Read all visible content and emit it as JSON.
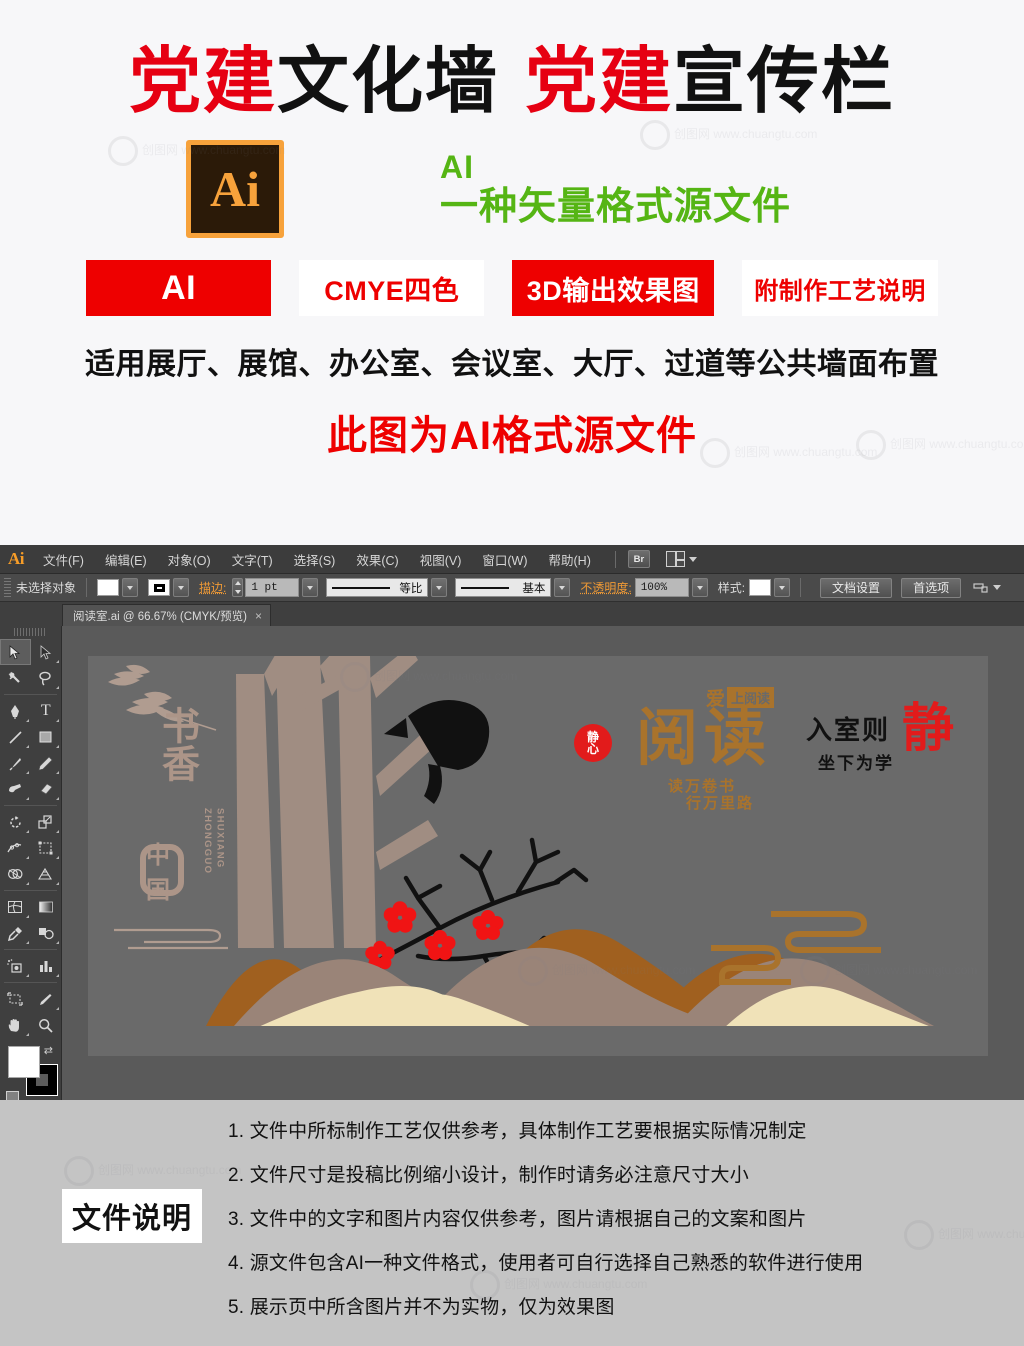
{
  "promo": {
    "title": {
      "seg1_red": "党建",
      "seg2_black": "文化墙",
      "seg3_red": "党建",
      "seg4_black": "宣传栏"
    },
    "ai_logo_text": "Ai",
    "green_line1": "AI",
    "green_line2": "一种矢量格式源文件",
    "badges": [
      {
        "label": "AI",
        "bg": "#ee0000",
        "fg": "#ffffff"
      },
      {
        "label": "CMYE四色",
        "bg": "#ffffff",
        "fg": "#ee0000"
      },
      {
        "label": "3D输出效果图",
        "bg": "#ee0000",
        "fg": "#ffffff"
      },
      {
        "label": "附制作工艺说明",
        "bg": "#ffffff",
        "fg": "#ee0000"
      }
    ],
    "subtitle": "适用展厅、展馆、办公室、会议室、大厅、过道等公共墙面布置",
    "note": "此图为AI格式源文件",
    "watermark": "创图网 www.chuangtu.com"
  },
  "app": {
    "logo": "Ai",
    "menus": [
      "文件(F)",
      "编辑(E)",
      "对象(O)",
      "文字(T)",
      "选择(S)",
      "效果(C)",
      "视图(V)",
      "窗口(W)",
      "帮助(H)"
    ],
    "bridge_button": "Br",
    "control_bar": {
      "selection_status": "未选择对象",
      "stroke_label": "描边:",
      "stroke_width": "1 pt",
      "profile": "等比",
      "brush": "基本",
      "opacity_label": "不透明度:",
      "opacity_value": "100%",
      "style_label": "样式:",
      "doc_setup_button": "文档设置",
      "preferences_button": "首选项"
    },
    "document_tab": {
      "title": "阅读室.ai @ 66.67% (CMYK/预览)",
      "close": "×"
    },
    "tools": [
      "selection-tool",
      "direct-selection-tool",
      "magic-wand-tool",
      "lasso-tool",
      "pen-tool",
      "type-tool",
      "line-segment-tool",
      "rectangle-tool",
      "paintbrush-tool",
      "pencil-tool",
      "blob-brush-tool",
      "eraser-tool",
      "rotate-tool",
      "scale-tool",
      "width-tool",
      "free-transform-tool",
      "shape-builder-tool",
      "perspective-grid-tool",
      "mesh-tool",
      "gradient-tool",
      "eyedropper-tool",
      "blend-tool",
      "symbol-sprayer-tool",
      "column-graph-tool",
      "artboard-tool",
      "slice-tool",
      "hand-tool",
      "zoom-tool"
    ],
    "fill_stroke": {
      "fill_color": "#ffffff",
      "stroke_color": "#000000",
      "swap": "swap-fill-stroke-icon",
      "default": "default-fill-stroke-icon",
      "modes": [
        "color-mode",
        "gradient-mode",
        "none-mode"
      ],
      "draw_modes": [
        "draw-normal",
        "draw-behind",
        "draw-inside"
      ]
    },
    "artwork": {
      "canvas_bg": "#5a5a5a",
      "artboard_bg": "#6a6a6a",
      "title_vertical": "书香",
      "pinyin_line1": "SHUXIANG",
      "pinyin_line2": "ZHONGGUO",
      "seal_text": "中国",
      "read_big": "阅读",
      "read_top_c1": "爱",
      "read_top_c2": "上阅读",
      "read_sub_l1": "读万卷书",
      "read_sub_l2": "行万里路",
      "jingxin_l1": "静",
      "jingxin_l2": "心",
      "right_line1": "入室则",
      "right_line2": "坐下为学",
      "right_big": "静",
      "colors": {
        "tree": "#a08d82",
        "calligraphy": "#ac9588",
        "brown_text": "#a9732c",
        "red": "#e21b1b",
        "mountain_dark": "#a0601f",
        "mountain_mid": "#9a8478",
        "mountain_light": "#f0e2b8",
        "bird": "#111111"
      }
    }
  },
  "footer": {
    "label": "文件说明",
    "lines": [
      "1. 文件中所标制作工艺仅供参考，具体制作工艺要根据实际情况制定",
      "2. 文件尺寸是投稿比例缩小设计，制作时请务必注意尺寸大小",
      "3. 文件中的文字和图片内容仅供参考，图片请根据自己的文案和图片",
      "4. 源文件包含AI一种文件格式，使用者可自行选择自己熟悉的软件进行使用",
      "5. 展示页中所含图片并不为实物，仅为效果图"
    ]
  }
}
